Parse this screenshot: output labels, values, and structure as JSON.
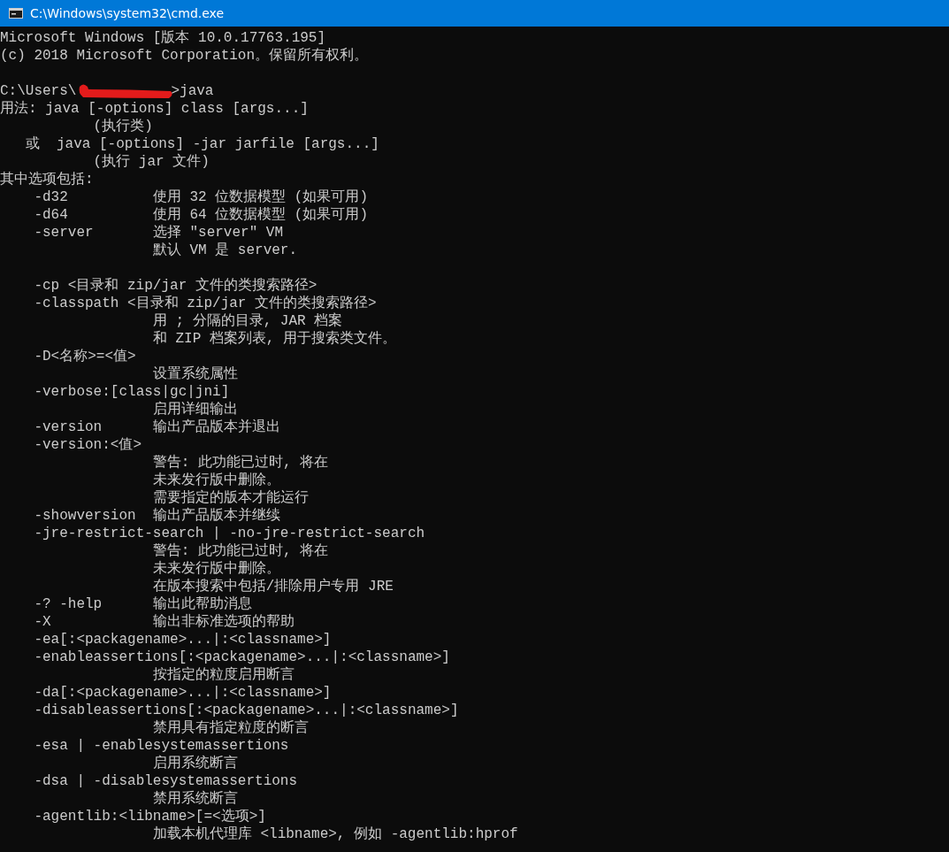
{
  "window": {
    "title": "C:\\Windows\\system32\\cmd.exe"
  },
  "console": {
    "lines": [
      {
        "kind": "text",
        "text": "Microsoft Windows [版本 10.0.17763.195]"
      },
      {
        "kind": "text",
        "text": "(c) 2018 Microsoft Corporation。保留所有权利。"
      },
      {
        "kind": "blank"
      },
      {
        "kind": "prompt",
        "path": "C:\\Users\\",
        "command": ">java"
      },
      {
        "kind": "text",
        "text": "用法: java [-options] class [args...]"
      },
      {
        "kind": "text",
        "text": "           (执行类)"
      },
      {
        "kind": "text",
        "text": "   或  java [-options] -jar jarfile [args...]"
      },
      {
        "kind": "text",
        "text": "           (执行 jar 文件)"
      },
      {
        "kind": "text",
        "text": "其中选项包括:"
      },
      {
        "kind": "text",
        "text": "    -d32          使用 32 位数据模型 (如果可用)"
      },
      {
        "kind": "text",
        "text": "    -d64          使用 64 位数据模型 (如果可用)"
      },
      {
        "kind": "text",
        "text": "    -server       选择 \"server\" VM"
      },
      {
        "kind": "text",
        "text": "                  默认 VM 是 server."
      },
      {
        "kind": "blank"
      },
      {
        "kind": "text",
        "text": "    -cp <目录和 zip/jar 文件的类搜索路径>"
      },
      {
        "kind": "text",
        "text": "    -classpath <目录和 zip/jar 文件的类搜索路径>"
      },
      {
        "kind": "text",
        "text": "                  用 ; 分隔的目录, JAR 档案"
      },
      {
        "kind": "text",
        "text": "                  和 ZIP 档案列表, 用于搜索类文件。"
      },
      {
        "kind": "text",
        "text": "    -D<名称>=<值>"
      },
      {
        "kind": "text",
        "text": "                  设置系统属性"
      },
      {
        "kind": "text",
        "text": "    -verbose:[class|gc|jni]"
      },
      {
        "kind": "text",
        "text": "                  启用详细输出"
      },
      {
        "kind": "text",
        "text": "    -version      输出产品版本并退出"
      },
      {
        "kind": "text",
        "text": "    -version:<值>"
      },
      {
        "kind": "text",
        "text": "                  警告: 此功能已过时, 将在"
      },
      {
        "kind": "text",
        "text": "                  未来发行版中删除。"
      },
      {
        "kind": "text",
        "text": "                  需要指定的版本才能运行"
      },
      {
        "kind": "text",
        "text": "    -showversion  输出产品版本并继续"
      },
      {
        "kind": "text",
        "text": "    -jre-restrict-search | -no-jre-restrict-search"
      },
      {
        "kind": "text",
        "text": "                  警告: 此功能已过时, 将在"
      },
      {
        "kind": "text",
        "text": "                  未来发行版中删除。"
      },
      {
        "kind": "text",
        "text": "                  在版本搜索中包括/排除用户专用 JRE"
      },
      {
        "kind": "text",
        "text": "    -? -help      输出此帮助消息"
      },
      {
        "kind": "text",
        "text": "    -X            输出非标准选项的帮助"
      },
      {
        "kind": "text",
        "text": "    -ea[:<packagename>...|:<classname>]"
      },
      {
        "kind": "text",
        "text": "    -enableassertions[:<packagename>...|:<classname>]"
      },
      {
        "kind": "text",
        "text": "                  按指定的粒度启用断言"
      },
      {
        "kind": "text",
        "text": "    -da[:<packagename>...|:<classname>]"
      },
      {
        "kind": "text",
        "text": "    -disableassertions[:<packagename>...|:<classname>]"
      },
      {
        "kind": "text",
        "text": "                  禁用具有指定粒度的断言"
      },
      {
        "kind": "text",
        "text": "    -esa | -enablesystemassertions"
      },
      {
        "kind": "text",
        "text": "                  启用系统断言"
      },
      {
        "kind": "text",
        "text": "    -dsa | -disablesystemassertions"
      },
      {
        "kind": "text",
        "text": "                  禁用系统断言"
      },
      {
        "kind": "text",
        "text": "    -agentlib:<libname>[=<选项>]"
      },
      {
        "kind": "text",
        "text": "                  加载本机代理库 <libname>, 例如 -agentlib:hprof"
      }
    ]
  }
}
